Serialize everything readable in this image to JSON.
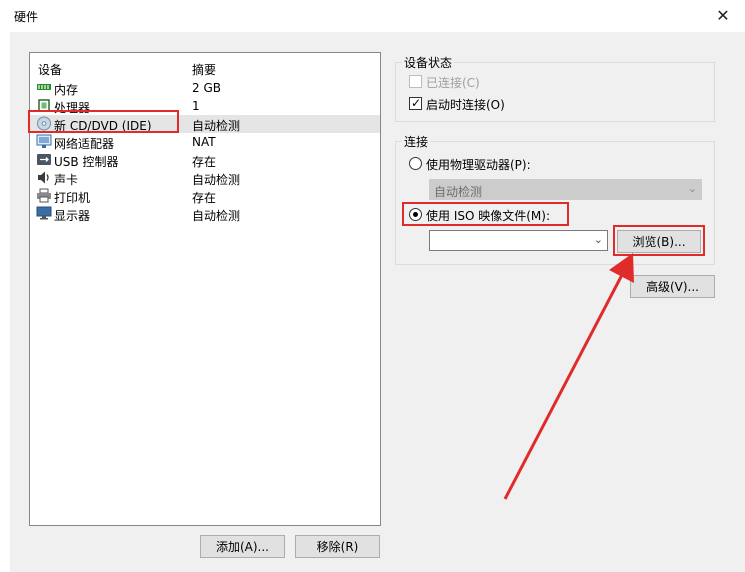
{
  "window": {
    "title": "硬件",
    "close_icon": "close-icon"
  },
  "device_list": {
    "headers": {
      "device": "设备",
      "summary": "摘要"
    },
    "rows": [
      {
        "name": "内存",
        "summary": "2 GB",
        "icon": "memory-icon"
      },
      {
        "name": "处理器",
        "summary": "1",
        "icon": "processor-icon"
      },
      {
        "name": "新 CD/DVD (IDE)",
        "summary": "自动检测",
        "icon": "cd-dvd-icon",
        "selected": true
      },
      {
        "name": "网络适配器",
        "summary": "NAT",
        "icon": "network-adapter-icon"
      },
      {
        "name": "USB 控制器",
        "summary": "存在",
        "icon": "usb-icon"
      },
      {
        "name": "声卡",
        "summary": "自动检测",
        "icon": "sound-card-icon"
      },
      {
        "name": "打印机",
        "summary": "存在",
        "icon": "printer-icon"
      },
      {
        "name": "显示器",
        "summary": "自动检测",
        "icon": "display-icon"
      }
    ],
    "add_button": "添加(A)...",
    "remove_button": "移除(R)"
  },
  "device_status": {
    "title": "设备状态",
    "connected": {
      "label": "已连接(C)",
      "checked": false,
      "disabled": true
    },
    "connect_at_power_on": {
      "label": "启动时连接(O)",
      "checked": true
    }
  },
  "connection": {
    "title": "连接",
    "physical_drive": {
      "label": "使用物理驱动器(P):",
      "selected": false
    },
    "physical_drive_select": {
      "value": "自动检测",
      "disabled": true
    },
    "iso_image": {
      "label": "使用 ISO 映像文件(M):",
      "selected": true
    },
    "iso_path": {
      "value": ""
    },
    "browse_button": "浏览(B)..."
  },
  "advanced_button": "高级(V)...",
  "annotation": {
    "highlight_color": "#e02b2b"
  }
}
